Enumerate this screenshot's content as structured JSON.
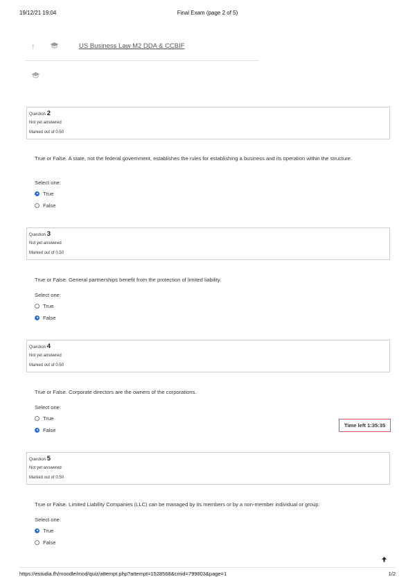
{
  "print_header": {
    "datetime": "19/12/21 19:04",
    "title": "Final Exam (page 2 of 5)"
  },
  "nav": {
    "course_link": "US Business Law M2 DDA & CCBIF",
    "up_icon": "arrow-up-icon",
    "cap_icon": "graduation-cap-icon"
  },
  "questions": [
    {
      "prefix": "Question ",
      "number": "2",
      "state": "Not yet answered",
      "marked": "Marked out of 0.50",
      "text": "True or False. A state, not the federal government, establishes the rules for establishing a business and its operation within the structure.",
      "select_label": "Select one:",
      "options": [
        {
          "label": "True",
          "checked": true
        },
        {
          "label": "False",
          "checked": false
        }
      ]
    },
    {
      "prefix": "Question ",
      "number": "3",
      "state": "Not yet answered",
      "marked": "Marked out of 0.50",
      "text": "True or False. General partnerships benefit from the protection of limited liability.",
      "select_label": "Select one:",
      "options": [
        {
          "label": "True",
          "checked": false
        },
        {
          "label": "False",
          "checked": true
        }
      ]
    },
    {
      "prefix": "Question ",
      "number": "4",
      "state": "Not yet answered",
      "marked": "Marked out of 0.50",
      "text": "True or False. Corporate directors are the owners of the corporations.",
      "select_label": "Select one:",
      "options": [
        {
          "label": "True",
          "checked": false
        },
        {
          "label": "False",
          "checked": true
        }
      ]
    },
    {
      "prefix": "Question ",
      "number": "5",
      "state": "Not yet answered",
      "marked": "Marked out of 0.50",
      "text": "True or False. Limited Liability Companies (LLC) can be managed by its members or by a non-member individual or group.",
      "select_label": "Select one:",
      "options": [
        {
          "label": "True",
          "checked": true
        },
        {
          "label": "False",
          "checked": false
        }
      ]
    }
  ],
  "timer": {
    "label": "Time left 1:35:35"
  },
  "back_to_top_icon": "arrow-up-icon",
  "print_footer": {
    "url": "https://estudia.fh/moodle/mod/quiz/attempt.php?attempt=1528568&cmid=799803&page=1",
    "page": "1/2"
  },
  "colors": {
    "radio_checked": "#2a6fd6",
    "timer_border": "#d9534f"
  }
}
